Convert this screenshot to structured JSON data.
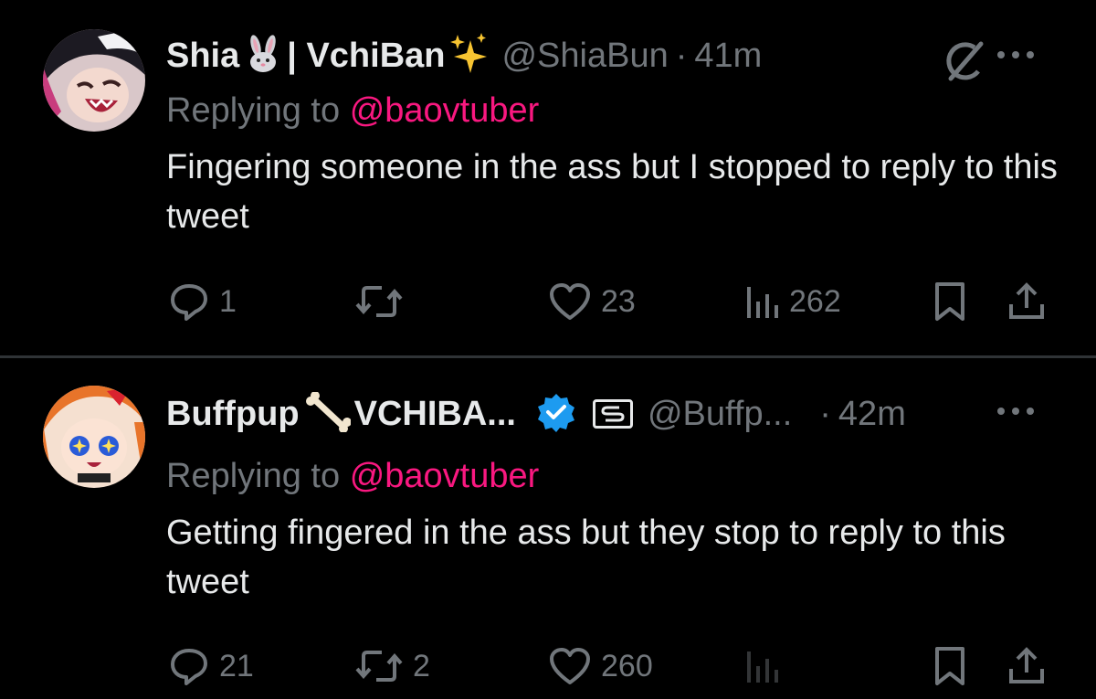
{
  "tweets": [
    {
      "name": "Shia",
      "name_suffix": "| VchiBan",
      "handle": "@ShiaBun",
      "separator": "·",
      "time": "41m",
      "replying_prefix": "Replying to",
      "replying_to": "@baovtuber",
      "text": "Fingering someone in the ass but I stopped to reply to this tweet",
      "replies": "1",
      "retweets": "",
      "likes": "23",
      "views": "262"
    },
    {
      "name": "Buffpup",
      "name_suffix": "VCHIBA...",
      "handle": "@Buffp...",
      "separator": "·",
      "time": "42m",
      "replying_prefix": "Replying to",
      "replying_to": "@baovtuber",
      "text": "Getting fingered in the ass but they stop to reply to this tweet",
      "replies": "21",
      "retweets": "2",
      "likes": "260",
      "views": ""
    }
  ],
  "icons": {
    "reply": "reply-icon",
    "retweet": "retweet-icon",
    "like": "heart-icon",
    "views": "views-icon",
    "bookmark": "bookmark-icon",
    "share": "share-icon",
    "more": "more-icon",
    "grok": "grok-icon",
    "verified": "verified-badge-icon",
    "affiliate": "affiliate-badge-icon"
  },
  "colors": {
    "background": "#000000",
    "text": "#e7e9ea",
    "muted": "#71767b",
    "mention": "#f91880",
    "verified": "#1d9bf0",
    "divider": "#2f3336"
  }
}
